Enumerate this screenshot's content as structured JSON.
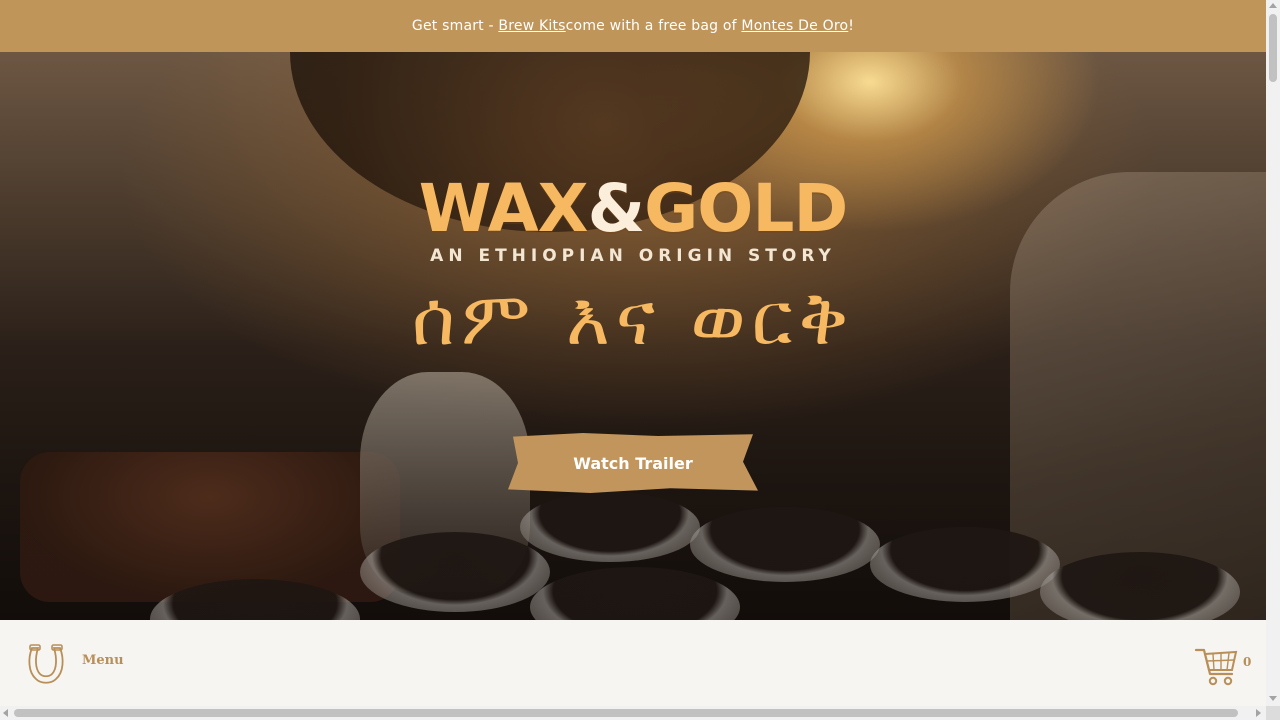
{
  "announcement": {
    "prefix": "Get smart - ",
    "link1": "Brew Kits",
    "middle": " come with a free bag of ",
    "link2": "Montes De Oro",
    "suffix": "!"
  },
  "hero": {
    "title_left": "WAX",
    "title_amp": "&",
    "title_right": "GOLD",
    "subtitle": "AN ETHIOPIAN ORIGIN STORY",
    "amharic": "ሰም እና ወርቅ",
    "cta_label": "Watch Trailer"
  },
  "nav": {
    "menu_label": "Menu",
    "menu_icon": "horseshoe-icon",
    "cart_icon": "cart-icon",
    "cart_count": "0"
  },
  "colors": {
    "accent": "#bf955a",
    "nav_text": "#b98f58",
    "title_gold": "#f6b861",
    "background": "#f6f5f2"
  }
}
